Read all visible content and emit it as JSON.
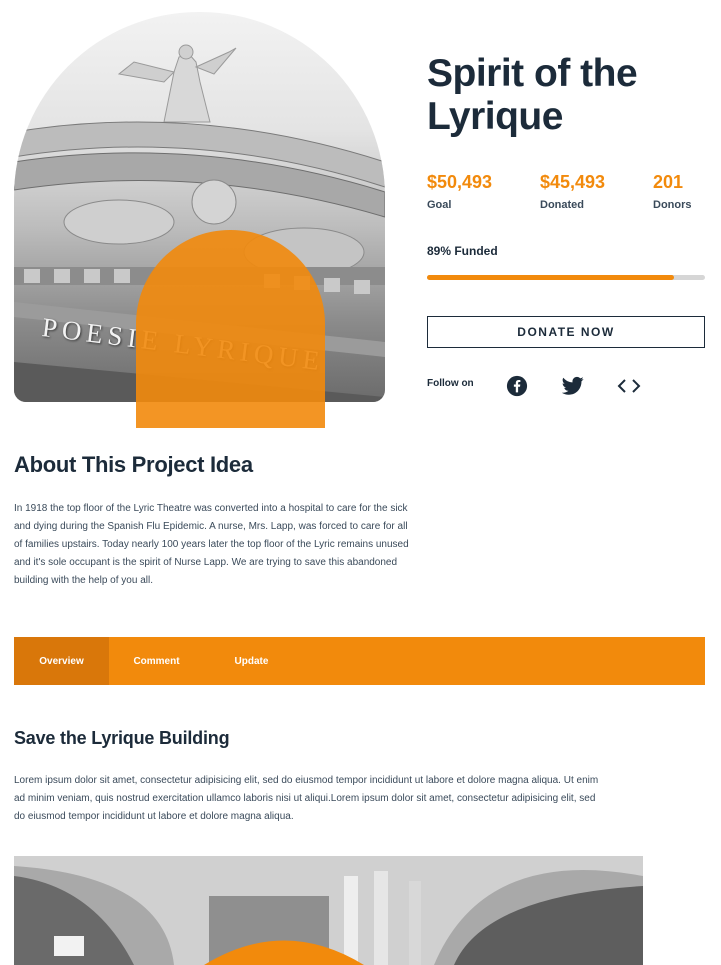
{
  "hero": {
    "engraving": "POESIE LYRIQUE"
  },
  "project": {
    "title": "Spirit of the Lyrique",
    "stats": [
      {
        "value": "$50,493",
        "label": "Goal"
      },
      {
        "value": "$45,493",
        "label": "Donated"
      },
      {
        "value": "201",
        "label": "Donors"
      }
    ],
    "funded_label": "89% Funded",
    "funded_fraction": 0.89,
    "donate_label": "DONATE NOW",
    "follow_label": "Follow on",
    "social_icons": [
      "facebook-icon",
      "twitter-icon",
      "embed-code-icon"
    ]
  },
  "about": {
    "title": "About This Project Idea",
    "text": "In 1918 the top floor of the Lyric Theatre was converted into a hospital to care for the sick and dying during the Spanish Flu Epidemic. A nurse, Mrs. Lapp, was forced to care for all of families upstairs. Today nearly 100 years later the top floor of the Lyric remains unused and it's sole occupant is the spirit of Nurse Lapp. We are trying to save this abandoned building with the help of you all."
  },
  "tabs": [
    {
      "label": "Overview",
      "active": true
    },
    {
      "label": "Comment",
      "active": false
    },
    {
      "label": "Update",
      "active": false
    }
  ],
  "overview": {
    "title": "Save the Lyrique Building",
    "text": "Lorem ipsum dolor sit amet, consectetur adipisicing elit, sed do eiusmod tempor incididunt ut labore et dolore magna aliqua. Ut enim ad minim veniam, quis nostrud exercitation ullamco laboris nisi ut aliqui.Lorem ipsum dolor sit amet, consectetur adipisicing elit, sed do eiusmod tempor incididunt ut labore et dolore magna aliqua."
  },
  "colors": {
    "accent": "#f28a0c",
    "accent_dark": "#d9770a",
    "heading": "#1c2b3a",
    "progress_track": "#d6d6d6"
  }
}
